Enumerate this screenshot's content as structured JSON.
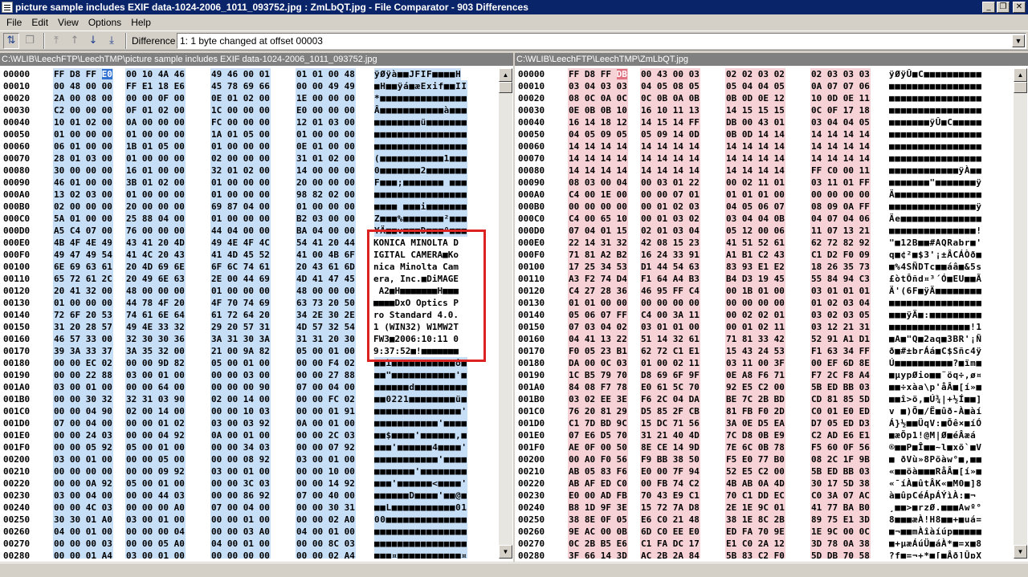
{
  "window": {
    "title": "picture sample includes EXIF data-1024-2006_1011_093752.jpg : ZmLbQT.jpg - File Comparator - 903 Differences"
  },
  "menu": [
    "File",
    "Edit",
    "View",
    "Options",
    "Help"
  ],
  "toolbar": {
    "difference_label": "Difference",
    "difference_value": "1: 1 byte changed at offset 00003"
  },
  "left": {
    "path": "C:\\WLIB\\LeechFTP\\LeechTMP\\picture sample includes EXIF data-1024-2006_1011_093752.jpg",
    "rows": [
      {
        "off": "00000",
        "hex": [
          "FF D8 FF E0",
          "00 10 4A 46",
          "49 46 00 01",
          "01 01 00 48"
        ],
        "asc": "ÿØÿà■■JFIF■■■■H"
      },
      {
        "off": "00010",
        "hex": [
          "00 48 00 00",
          "FF E1 18 E6",
          "45 78 69 66",
          "00 00 49 49"
        ],
        "asc": "■H■■ÿá■æExif■■II"
      },
      {
        "off": "00020",
        "hex": [
          "2A 00 08 00",
          "00 00 0F 00",
          "0E 01 02 00",
          "1E 00 00 00"
        ],
        "asc": "*■■■■■■■■■■■■■■■"
      },
      {
        "off": "00030",
        "hex": [
          "C2 00 00 00",
          "0F 01 02 00",
          "1C 00 00 00",
          "E0 00 00 00"
        ],
        "asc": "Â■■■■■■■■■■■à■■■"
      },
      {
        "off": "00040",
        "hex": [
          "10 01 02 00",
          "0A 00 00 00",
          "FC 00 00 00",
          "12 01 03 00"
        ],
        "asc": "■■■■■■■■ü■■■■■■■"
      },
      {
        "off": "00050",
        "hex": [
          "01 00 00 00",
          "01 00 00 00",
          "1A 01 05 00",
          "01 00 00 00"
        ],
        "asc": "■■■■■■■■■■■■■■■■"
      },
      {
        "off": "00060",
        "hex": [
          "06 01 00 00",
          "1B 01 05 00",
          "01 00 00 00",
          "0E 01 00 00"
        ],
        "asc": "■■■■■■■■■■■■■■■■"
      },
      {
        "off": "00070",
        "hex": [
          "28 01 03 00",
          "01 00 00 00",
          "02 00 00 00",
          "31 01 02 00"
        ],
        "asc": "(■■■■■■■■■■■1■■■"
      },
      {
        "off": "00080",
        "hex": [
          "30 00 00 00",
          "16 01 00 00",
          "32 01 02 00",
          "14 00 00 00"
        ],
        "asc": "0■■■■■■■2■■■■■■■"
      },
      {
        "off": "00090",
        "hex": [
          "46 01 00 00",
          "3B 01 02 00",
          "01 00 00 00",
          "20 00 00 00"
        ],
        "asc": "F■■■;■■■■■■■ ■■■"
      },
      {
        "off": "000A0",
        "hex": [
          "13 02 03 00",
          "01 00 00 00",
          "01 00 00 00",
          "98 82 02 00"
        ],
        "asc": "■■■■■■■■■■■■■■■■"
      },
      {
        "off": "000B0",
        "hex": [
          "02 00 00 00",
          "20 00 00 00",
          "69 87 04 00",
          "01 00 00 00"
        ],
        "asc": "■■■■ ■■■i■■■■■■■"
      },
      {
        "off": "000C0",
        "hex": [
          "5A 01 00 00",
          "25 88 04 00",
          "01 00 00 00",
          "B2 03 00 00"
        ],
        "asc": "Z■■■%■■■■■■■²■■■"
      },
      {
        "off": "000D0",
        "hex": [
          "A5 C4 07 00",
          "76 00 00 00",
          "44 04 00 00",
          "BA 04 00 00"
        ],
        "asc": "¥Ä■■v■■■D■■■º■■■"
      },
      {
        "off": "000E0",
        "hex": [
          "4B 4F 4E 49",
          "43 41 20 4D",
          "49 4E 4F 4C",
          "54 41 20 44"
        ],
        "asc": "KONICA MINOLTA D"
      },
      {
        "off": "000F0",
        "hex": [
          "49 47 49 54",
          "41 4C 20 43",
          "41 4D 45 52",
          "41 00 4B 6F"
        ],
        "asc": "IGITAL CAMERA■Ko"
      },
      {
        "off": "00100",
        "hex": [
          "6E 69 63 61",
          "20 4D 69 6E",
          "6F 6C 74 61",
          "20 43 61 6D"
        ],
        "asc": "nica Minolta Cam"
      },
      {
        "off": "00110",
        "hex": [
          "65 72 61 2C",
          "20 49 6E 63",
          "2E 00 44 69",
          "4D 41 47 45"
        ],
        "asc": "era, Inc.■DiMAGE"
      },
      {
        "off": "00120",
        "hex": [
          "20 41 32 00",
          "48 00 00 00",
          "01 00 00 00",
          "48 00 00 00"
        ],
        "asc": " A2■H■■■■■■■H■■■"
      },
      {
        "off": "00130",
        "hex": [
          "01 00 00 00",
          "44 78 4F 20",
          "4F 70 74 69",
          "63 73 20 50"
        ],
        "asc": "■■■■DxO Optics P"
      },
      {
        "off": "00140",
        "hex": [
          "72 6F 20 53",
          "74 61 6E 64",
          "61 72 64 20",
          "34 2E 30 2E"
        ],
        "asc": "ro Standard 4.0."
      },
      {
        "off": "00150",
        "hex": [
          "31 20 28 57",
          "49 4E 33 32",
          "29 20 57 31",
          "4D 57 32 54"
        ],
        "asc": "1 (WIN32) W1MW2T"
      },
      {
        "off": "00160",
        "hex": [
          "46 57 33 00",
          "32 30 30 36",
          "3A 31 30 3A",
          "31 31 20 30"
        ],
        "asc": "FW3■2006:10:11 0"
      },
      {
        "off": "00170",
        "hex": [
          "39 3A 33 37",
          "3A 35 32 00",
          "21 00 9A 82",
          "05 00 01 00"
        ],
        "asc": "9:37:52■!■■■■■■■"
      },
      {
        "off": "00180",
        "hex": [
          "00 00 EC 02",
          "00 00 9D 82",
          "05 00 01 00",
          "00 00 F4 02"
        ],
        "asc": "■■ì■■■■■■■■■■■ô■"
      },
      {
        "off": "00190",
        "hex": [
          "00 00 22 88",
          "03 00 01 00",
          "00 00 03 00",
          "00 00 27 88"
        ],
        "asc": "■■\"■■■■■■■■■■■'■"
      },
      {
        "off": "001A0",
        "hex": [
          "03 00 01 00",
          "00 00 64 00",
          "00 00 00 90",
          "07 00 04 00"
        ],
        "asc": "■■■■■■d■■■■■■■■■"
      },
      {
        "off": "001B0",
        "hex": [
          "00 00 30 32",
          "32 31 03 90",
          "02 00 14 00",
          "00 00 FC 02"
        ],
        "asc": "■■0221■■■■■■■■ü■"
      },
      {
        "off": "001C0",
        "hex": [
          "00 00 04 90",
          "02 00 14 00",
          "00 00 10 03",
          "00 00 01 91"
        ],
        "asc": "■■■■■■■■■■■■■■■'"
      },
      {
        "off": "001D0",
        "hex": [
          "07 00 04 00",
          "00 00 01 02",
          "03 00 03 92",
          "0A 00 01 00"
        ],
        "asc": "■■■■■■■■■■■'■■■■"
      },
      {
        "off": "001E0",
        "hex": [
          "00 00 24 03",
          "00 00 04 92",
          "0A 00 01 00",
          "00 00 2C 03"
        ],
        "asc": "■■$■■■■'■■■■■■,■"
      },
      {
        "off": "001F0",
        "hex": [
          "00 00 05 92",
          "05 00 01 00",
          "00 00 34 03",
          "00 00 07 92"
        ],
        "asc": "■■■'■■■■■■4■■■■'"
      },
      {
        "off": "00200",
        "hex": [
          "03 00 01 00",
          "00 00 05 00",
          "00 00 08 92",
          "03 00 01 00"
        ],
        "asc": "■■■■■■■■■■■'■■■■"
      },
      {
        "off": "00210",
        "hex": [
          "00 00 00 00",
          "00 00 09 92",
          "03 00 01 00",
          "00 00 10 00"
        ],
        "asc": "■■■■■■■'■■■■■■■■"
      },
      {
        "off": "00220",
        "hex": [
          "00 00 0A 92",
          "05 00 01 00",
          "00 00 3C 03",
          "00 00 14 92"
        ],
        "asc": "■■■'■■■■■■<■■■■'"
      },
      {
        "off": "00230",
        "hex": [
          "03 00 04 00",
          "00 00 44 03",
          "00 00 86 92",
          "07 00 40 00"
        ],
        "asc": "■■■■■■D■■■■'■■@■"
      },
      {
        "off": "00240",
        "hex": [
          "00 00 4C 03",
          "00 00 00 A0",
          "07 00 04 00",
          "00 00 30 31"
        ],
        "asc": "■■L■■■■■■■■■■■01"
      },
      {
        "off": "00250",
        "hex": [
          "30 30 01 A0",
          "03 00 01 00",
          "00 00 01 00",
          "00 00 02 A0"
        ],
        "asc": "00■■■■■■■■■■■■■■"
      },
      {
        "off": "00260",
        "hex": [
          "04 00 01 00",
          "00 00 00 04",
          "00 00 03 A0",
          "04 00 01 00"
        ],
        "asc": "■■■■■■■■■■■■■■■■"
      },
      {
        "off": "00270",
        "hex": [
          "00 00 00 03",
          "00 00 05 A0",
          "04 00 01 00",
          "00 00 8C 03"
        ],
        "asc": "■■■■■■■■■■■■■■■■"
      },
      {
        "off": "00280",
        "hex": [
          "00 00 01 A4",
          "03 00 01 00",
          "00 00 00 00",
          "00 00 02 A4"
        ],
        "asc": "■■■¤■■■■■■■■■■■¤"
      }
    ]
  },
  "right": {
    "path": "C:\\WLIB\\LeechFTP\\LeechTMP\\ZmLbQT.jpg",
    "rows": [
      {
        "off": "00000",
        "hex": [
          "FF D8 FF DB",
          "00 43 00 03",
          "02 02 03 02",
          "02 03 03 03"
        ],
        "asc": "ÿØÿÛ■C■■■■■■■■■■"
      },
      {
        "off": "00010",
        "hex": [
          "03 04 03 03",
          "04 05 08 05",
          "05 04 04 05",
          "0A 07 07 06"
        ],
        "asc": "■■■■■■■■■■■■■■■■"
      },
      {
        "off": "00020",
        "hex": [
          "08 0C 0A 0C",
          "0C 0B 0A 0B",
          "0B 0D 0E 12",
          "10 0D 0E 11"
        ],
        "asc": "■■■■■■■■■■■■■■■■"
      },
      {
        "off": "00030",
        "hex": [
          "0E 0B 0B 10",
          "16 10 11 13",
          "14 15 15 15",
          "0C 0F 17 18"
        ],
        "asc": "■■■■■■■■■■■■■■■■"
      },
      {
        "off": "00040",
        "hex": [
          "16 14 18 12",
          "14 15 14 FF",
          "DB 00 43 01",
          "03 04 04 05"
        ],
        "asc": "■■■■■■■ÿÛ■C■■■■■"
      },
      {
        "off": "00050",
        "hex": [
          "04 05 09 05",
          "05 09 14 0D",
          "0B 0D 14 14",
          "14 14 14 14"
        ],
        "asc": "■■■■■■■■■■■■■■■■"
      },
      {
        "off": "00060",
        "hex": [
          "14 14 14 14",
          "14 14 14 14",
          "14 14 14 14",
          "14 14 14 14"
        ],
        "asc": "■■■■■■■■■■■■■■■■"
      },
      {
        "off": "00070",
        "hex": [
          "14 14 14 14",
          "14 14 14 14",
          "14 14 14 14",
          "14 14 14 14"
        ],
        "asc": "■■■■■■■■■■■■■■■■"
      },
      {
        "off": "00080",
        "hex": [
          "14 14 14 14",
          "14 14 14 14",
          "14 14 14 14",
          "FF C0 00 11"
        ],
        "asc": "■■■■■■■■■■■■ÿÀ■■"
      },
      {
        "off": "00090",
        "hex": [
          "08 03 00 04",
          "00 03 01 22",
          "00 02 11 01",
          "03 11 01 FF"
        ],
        "asc": "■■■■■■■\"■■■■■■■ÿ"
      },
      {
        "off": "000A0",
        "hex": [
          "C4 00 1E 00",
          "00 00 07 01",
          "01 01 01 00",
          "00 00 00 00"
        ],
        "asc": "Ä■■■■■■■■■■■■■■■"
      },
      {
        "off": "000B0",
        "hex": [
          "00 00 00 00",
          "00 01 02 03",
          "04 05 06 07",
          "08 09 0A FF"
        ],
        "asc": "■■■■■■■■■■■■■■■ÿ"
      },
      {
        "off": "000C0",
        "hex": [
          "C4 00 65 10",
          "00 01 03 02",
          "03 04 04 0B",
          "04 07 04 06"
        ],
        "asc": "Äe■■■■■■■■■■■■■■"
      },
      {
        "off": "000D0",
        "hex": [
          "07 04 01 15",
          "02 01 03 04",
          "05 12 00 06",
          "11 07 13 21"
        ],
        "asc": "■■■■■■■■■■■■■■■!"
      },
      {
        "off": "000E0",
        "hex": [
          "22 14 31 32",
          "42 08 15 23",
          "41 51 52 61",
          "62 72 82 92"
        ],
        "asc": "\"■12B■■#AQRabr■'"
      },
      {
        "off": "000F0",
        "hex": [
          "71 81 A2 B2",
          "16 24 33 91",
          "A1 B1 C2 43",
          "C1 D2 F0 09"
        ],
        "asc": "q■¢²■$3'¡±ÂCÁÒð■"
      },
      {
        "off": "00100",
        "hex": [
          "17 25 34 53",
          "D1 44 54 63",
          "83 93 E1 E2",
          "18 26 35 73"
        ],
        "asc": "■%4SÑDTc■■áâ■&5s"
      },
      {
        "off": "00110",
        "hex": [
          "A3 F2 74 D4",
          "F1 64 A4 B3",
          "B4 D3 19 45",
          "55 84 94 C3"
        ],
        "asc": "£òtÔñd¤³´Ó■EU■■Ã"
      },
      {
        "off": "00120",
        "hex": [
          "C4 27 28 36",
          "46 95 FF C4",
          "00 1B 01 00",
          "03 01 01 01"
        ],
        "asc": "Ä'(6F■ÿÄ■■■■■■■■"
      },
      {
        "off": "00130",
        "hex": [
          "01 01 00 00",
          "00 00 00 00",
          "00 00 00 00",
          "01 02 03 04"
        ],
        "asc": "■■■■■■■■■■■■■■■■"
      },
      {
        "off": "00140",
        "hex": [
          "05 06 07 FF",
          "C4 00 3A 11",
          "00 02 02 01",
          "03 02 03 05"
        ],
        "asc": "■■■ÿÄ■:■■■■■■■■■"
      },
      {
        "off": "00150",
        "hex": [
          "07 03 04 02",
          "03 01 01 00",
          "00 01 02 11",
          "03 12 21 31"
        ],
        "asc": "■■■■■■■■■■■■■■!1"
      },
      {
        "off": "00160",
        "hex": [
          "04 41 13 22",
          "51 14 32 61",
          "71 81 33 42",
          "52 91 A1 D1"
        ],
        "asc": "■A■\"Q■2aq■3BR'¡Ñ"
      },
      {
        "off": "00170",
        "hex": [
          "F0 05 23 B1",
          "62 72 C1 E1",
          "15 43 24 53",
          "F1 63 34 FF"
        ],
        "asc": "ð■#±brÁá■C$Sñc4ÿ"
      },
      {
        "off": "00180",
        "hex": [
          "DA 00 0C 03",
          "01 00 02 11",
          "03 11 00 3F",
          "00 EF 6D 8E"
        ],
        "asc": "Ú■■■■■■■■■■?■ïm■"
      },
      {
        "off": "00190",
        "hex": [
          "1C B5 79 70",
          "D8 69 6F 9F",
          "0E A8 F6 71",
          "F7 2C F8 A4"
        ],
        "asc": "■µypØio■■¨öq÷,ø¤"
      },
      {
        "off": "001A0",
        "hex": [
          "84 08 F7 78",
          "E0 61 5C 70",
          "92 E5 C2 00",
          "5B ED BB 03"
        ],
        "asc": "■■÷xàa\\p'åÂ■[í»■"
      },
      {
        "off": "001B0",
        "hex": [
          "03 02 EE 3E",
          "F6 2C 04 DA",
          "BE 7C 2B BD",
          "CD 81 85 5D"
        ],
        "asc": "■■î>ö,■Ú¾|+½Í■■]"
      },
      {
        "off": "001C0",
        "hex": [
          "76 20 81 29",
          "D5 85 2F CB",
          "81 FB F0 2D",
          "C0 01 E0 ED"
        ],
        "asc": "v ■)Õ■/Ë■ûð-À■àí"
      },
      {
        "off": "001D0",
        "hex": [
          "C1 7D BD 9C",
          "15 DC 71 56",
          "3A 0E D5 EA",
          "D7 05 ED D3"
        ],
        "asc": "Á}½■■ÜqV:■Õê×■íÓ"
      },
      {
        "off": "001E0",
        "hex": [
          "07 E6 D5 70",
          "31 21 40 4D",
          "7C D8 0B E9",
          "C2 AD E6 E1"
        ],
        "asc": "■æÕp1!@M|Ø■éÂ­æá"
      },
      {
        "off": "001F0",
        "hex": [
          "AE 0F 00 50",
          "8E CE 14 9D",
          "7E 6C 0B 78",
          "F5 60 0F 56"
        ],
        "asc": "®■■P■Î■■~l■xõ`■V"
      },
      {
        "off": "00200",
        "hex": [
          "00 A0 F0 56",
          "F9 BB 38 50",
          "F5 E0 77 B0",
          "08 2C 1F 9B"
        ],
        "asc": "■ ðVù»8Põàw°■,■■"
      },
      {
        "off": "00210",
        "hex": [
          "AB 05 83 F6",
          "E0 00 7F 94",
          "52 E5 C2 00",
          "5B ED BB 03"
        ],
        "asc": "«■■öà■■■RåÂ■[í»■"
      },
      {
        "off": "00220",
        "hex": [
          "AB AF ED C0",
          "00 FB 74 C2",
          "4B AB 0A 4D",
          "30 17 5D 38"
        ],
        "asc": "«¯íÀ■ûtÂK«■M0■]8"
      },
      {
        "off": "00230",
        "hex": [
          "E0 00 AD FB",
          "70 43 E9 C1",
          "70 C1 DD EC",
          "C0 3A 07 AC"
        ],
        "asc": "à■­ûpCéÁpÁÝìÀ:■¬"
      },
      {
        "off": "00240",
        "hex": [
          "B8 1D 9F 3E",
          "15 72 7A D8",
          "2E 1E 9C 01",
          "41 77 BA B0"
        ],
        "asc": "¸■■>■rzØ.■■■Awº°"
      },
      {
        "off": "00250",
        "hex": [
          "38 8E 0F 05",
          "E6 C0 21 48",
          "38 1E 8C 2B",
          "89 75 E1 3D"
        ],
        "asc": "8■■■æÀ!H8■■+■uá="
      },
      {
        "off": "00260",
        "hex": [
          "9E AC 00 0B",
          "6D C0 EE E0",
          "ED FA 70 9E",
          "1E 9C 00 0C"
        ],
        "asc": "■¬■■mÀîàíúp■■■■■"
      },
      {
        "off": "00270",
        "hex": [
          "0C 2B B5 E6",
          "C1 FA DC 17",
          "E1 C0 2A 12",
          "3D 78 0A 38"
        ],
        "asc": "■+µæÁúÜ■áÀ*■=x■8"
      },
      {
        "off": "00280",
        "hex": [
          "3F 66 14 3D",
          "AC 2B 2A 84",
          "5B 83 C2 F0",
          "5D DB 70 58"
        ],
        "asc": "?f■=¬+*■[■Âð]ÛpX"
      }
    ]
  },
  "redbox_lines": [
    "KONICA MINOLTA D",
    "IGITAL CAMERA■Ko",
    "nica Minolta Cam",
    "era, Inc.■DiMAGE",
    " A2■H■■■■■■■H■■■",
    "■■■■DxO Optics P",
    "ro Standard 4.0.",
    "1 (WIN32) W1MW2T",
    "FW3■2006:10:11 0",
    "9:37:52■!■■■■■■■"
  ]
}
